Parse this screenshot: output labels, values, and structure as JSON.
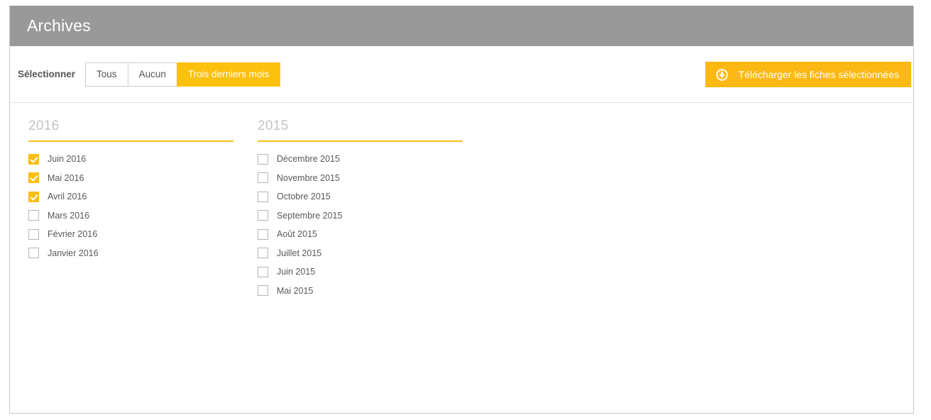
{
  "header": {
    "title": "Archives"
  },
  "toolbar": {
    "select_label": "Sélectionner",
    "buttons": [
      {
        "label": "Tous",
        "active": false
      },
      {
        "label": "Aucun",
        "active": false
      },
      {
        "label": "Trois derniers mois",
        "active": true
      }
    ],
    "download": {
      "label": "Télécharger les fiches sélectionnées",
      "icon": "download-circle-icon",
      "color": "#fcb813"
    }
  },
  "colors": {
    "accent": "#fcbc12",
    "header_bg": "#999999",
    "panel_border": "#c9c9c9",
    "heading_text": "#c4c4c4",
    "label_text": "#595959"
  },
  "columns": [
    {
      "year": "2016",
      "months": [
        {
          "label": "Juin 2016",
          "checked": true
        },
        {
          "label": "Mai 2016",
          "checked": true
        },
        {
          "label": "Avril 2016",
          "checked": true
        },
        {
          "label": "Mars 2016",
          "checked": false
        },
        {
          "label": "Février 2016",
          "checked": false
        },
        {
          "label": "Janvier 2016",
          "checked": false
        }
      ]
    },
    {
      "year": "2015",
      "months": [
        {
          "label": "Décembre 2015",
          "checked": false
        },
        {
          "label": "Novembre 2015",
          "checked": false
        },
        {
          "label": "Octobre 2015",
          "checked": false
        },
        {
          "label": "Septembre 2015",
          "checked": false
        },
        {
          "label": "Août 2015",
          "checked": false
        },
        {
          "label": "Juillet 2015",
          "checked": false
        },
        {
          "label": "Juin 2015",
          "checked": false
        },
        {
          "label": "Mai 2015",
          "checked": false
        }
      ]
    }
  ]
}
